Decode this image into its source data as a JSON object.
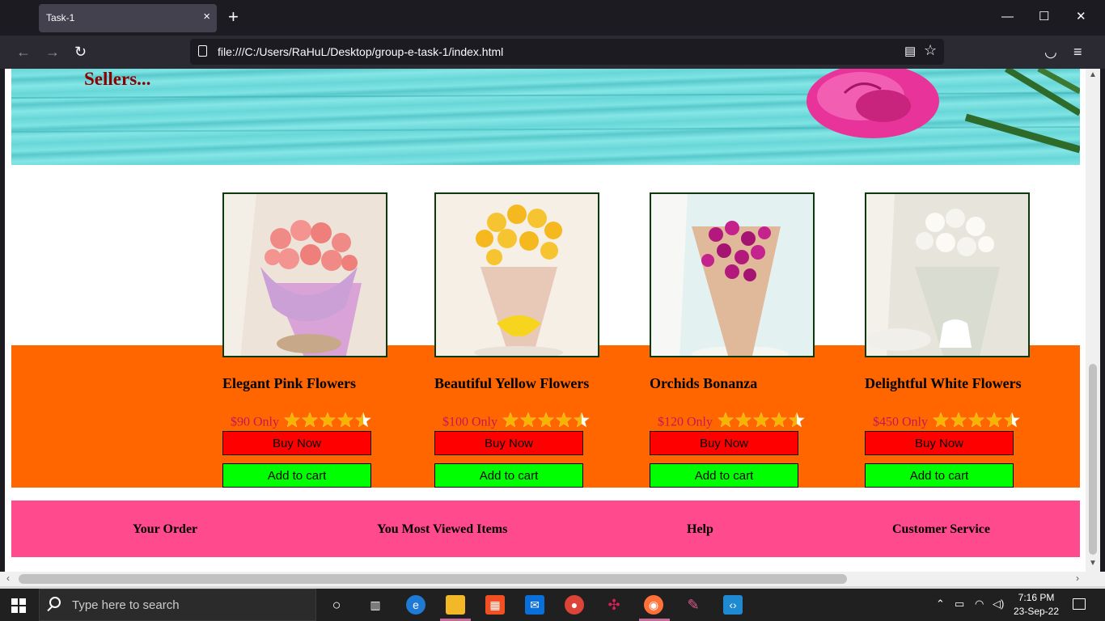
{
  "browser": {
    "tab_title": "Task-1",
    "tab_close": "×",
    "new_tab": "+",
    "url": "file:///C:/Users/RaHuL/Desktop/group-e-task-1/index.html"
  },
  "banner": {
    "title": "Sellers..."
  },
  "products": [
    {
      "name": "Elegant Pink Flowers",
      "price": "$90 Only",
      "rating": 4.5,
      "buy_label": "Buy Now",
      "cart_label": "Add to cart",
      "image": "pink-rose-bouquet"
    },
    {
      "name": "Beautiful Yellow Flowers",
      "price": "$100 Only",
      "rating": 4.5,
      "buy_label": "Buy Now",
      "cart_label": "Add to cart",
      "image": "yellow-rose-bouquet"
    },
    {
      "name": "Orchids Bonanza",
      "price": "$120 Only",
      "rating": 4.5,
      "buy_label": "Buy Now",
      "cart_label": "Add to cart",
      "image": "purple-orchid-bouquet"
    },
    {
      "name": "Delightful White Flowers",
      "price": "$450 Only",
      "rating": 4.5,
      "buy_label": "Buy Now",
      "cart_label": "Add to cart",
      "image": "white-rose-bouquet"
    }
  ],
  "footer": {
    "links": [
      "Your Order",
      "You Most Viewed Items",
      "Help",
      "Customer Service"
    ]
  },
  "colors": {
    "banner_title": "#8b0000",
    "orange_band": "#ff6600",
    "buy_button": "#ff0000",
    "cart_button": "#00ff00",
    "footer_bar": "#ff4a8d",
    "price_text": "#c2185b",
    "star": "#f7b500"
  },
  "taskbar": {
    "search_placeholder": "Type here to search",
    "time": "7:16 PM",
    "date": "23-Sep-22",
    "apps": [
      "task-view-icon",
      "edge-icon",
      "file-explorer-icon",
      "store-icon",
      "mail-icon",
      "chrome-icon",
      "slack-icon",
      "firefox-icon",
      "paint-icon",
      "vscode-icon"
    ]
  }
}
